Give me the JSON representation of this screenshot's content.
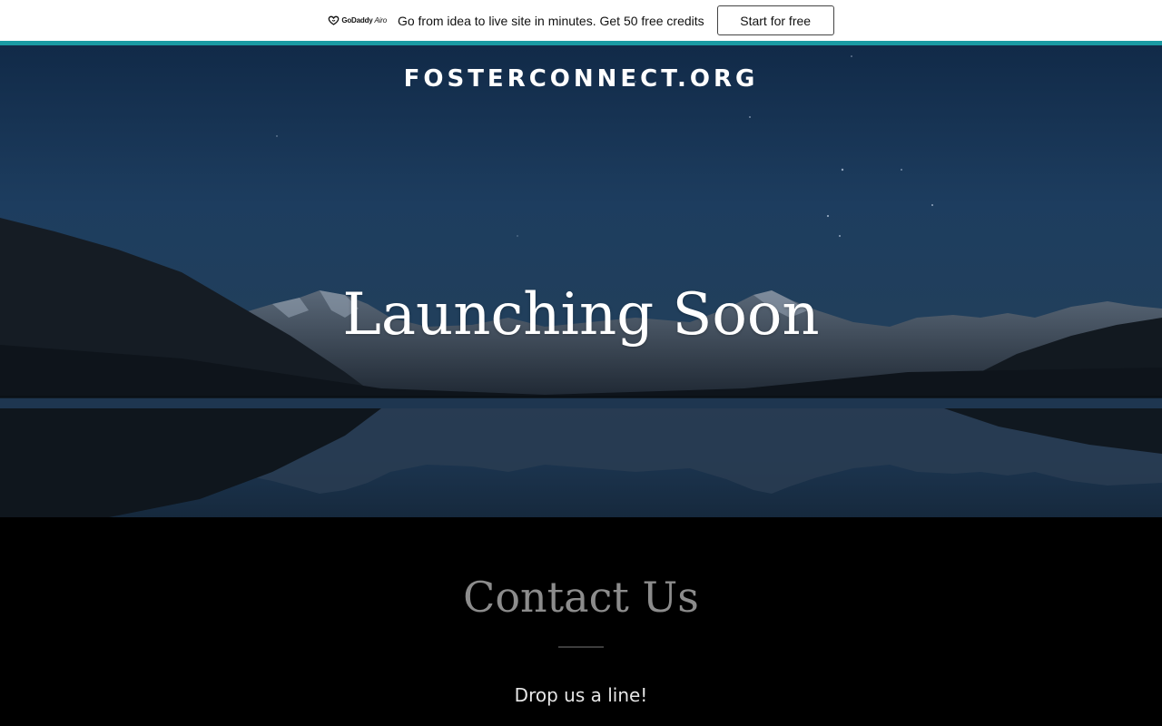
{
  "promo_bar": {
    "logo_brand": "GoDaddy",
    "logo_product": "Airo",
    "message": "Go from idea to live site in minutes. Get 50 free credits",
    "cta_label": "Start for free"
  },
  "colors": {
    "accent_line": "#1a9aa3",
    "hero_sky": "#1b3a5c",
    "contact_bg": "#000000",
    "contact_heading": "#8c8c8c"
  },
  "hero": {
    "site_title": "FOSTERCONNECT.ORG",
    "heading": "Launching Soon"
  },
  "contact": {
    "heading": "Contact Us",
    "subtext": "Drop us a line!"
  }
}
